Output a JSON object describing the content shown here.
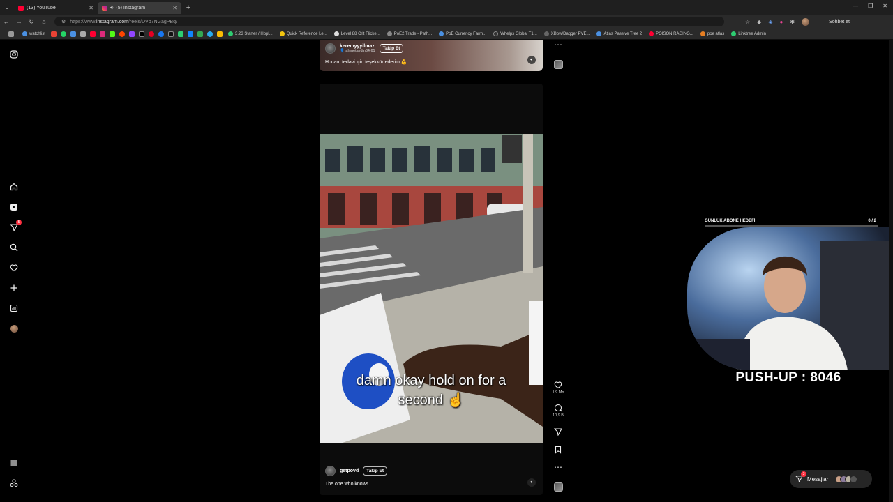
{
  "browser": {
    "tabs": [
      {
        "title": "(13) YouTube",
        "color": "#ff0033"
      },
      {
        "title": "(5) Instagram",
        "color": "#e1306c"
      }
    ],
    "url_prefix": "https://www.",
    "url_domain": "instagram.com",
    "url_path": "/reels/DVb7NGagPBq/",
    "sohbet_label": "Sohbet et",
    "bookmarks": [
      {
        "label": "watchlist",
        "color": "#4a90e2"
      },
      {
        "label": "3.23 Starter / Hopl...",
        "color": "#2ecc71"
      },
      {
        "label": "Quick Reference Le...",
        "color": "#f1c40f"
      },
      {
        "label": "Level 88 Crit Flicke...",
        "color": "#ddd"
      },
      {
        "label": "PoE2 Trade - Path...",
        "color": "#888"
      },
      {
        "label": "PoE Currency Farm...",
        "color": "#4a90e2"
      },
      {
        "label": "Whelps Global T1...",
        "color": "#333"
      },
      {
        "label": "XBow/Dagger PVE...",
        "color": "#666"
      },
      {
        "label": "Atlas Passive Tree 2",
        "color": "#4a90e2"
      },
      {
        "label": "POISON RAGING...",
        "color": "#ff0033"
      },
      {
        "label": "poe atlas",
        "color": "#e67e22"
      },
      {
        "label": "Linktree Admin",
        "color": "#2ecc71"
      }
    ]
  },
  "sidebar": {
    "notif_count": "5"
  },
  "reel_top": {
    "username": "keremyyyilmaz",
    "sub_user": "ahmetaydin34.61",
    "follow_label": "Takip Et",
    "caption": "Hocam tedavi için teşekkür ederim 💪"
  },
  "reel_main": {
    "overlay_text_line1": "damn okay hold on for a",
    "overlay_text_line2": "second ☝",
    "username": "getpovd",
    "follow_label": "Takip Et",
    "caption": "The one who knows",
    "likes": "1,9 Mn",
    "comments": "10,9 B"
  },
  "stream": {
    "goal_label": "GÜNLÜK ABONE HEDEFİ",
    "goal_count": "0 / 2",
    "goal_progress": 0,
    "pushup_text": "PUSH-UP : 8046"
  },
  "messages": {
    "label": "Mesajlar",
    "badge": "3"
  }
}
